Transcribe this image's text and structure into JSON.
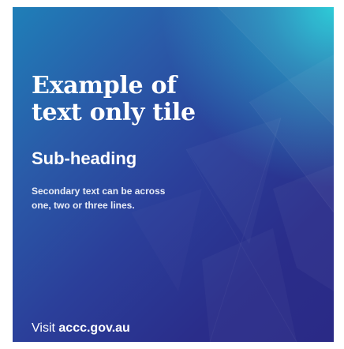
{
  "tile": {
    "heading_line1": "Example of",
    "heading_line2": "text only tile",
    "subheading": "Sub-heading",
    "secondary_line1": "Secondary text can be across",
    "secondary_line2": "one, two or three lines.",
    "visit_prefix": "Visit",
    "visit_url": "accc.gov.au"
  },
  "colors": {
    "accent_teal": "#26c9d6",
    "background_blue": "#2b3f9a",
    "background_deep": "#2a2a86",
    "text": "#ffffff"
  }
}
